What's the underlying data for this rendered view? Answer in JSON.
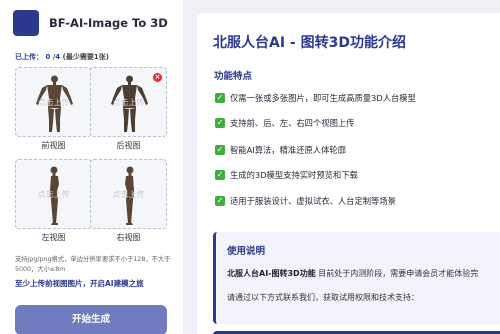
{
  "app": {
    "title": "BF-AI-Image To 3D"
  },
  "upload": {
    "status_label": "已上传：",
    "status_count": "0 /4",
    "status_note": "(最少需要1张)",
    "placeholder": "点击上传",
    "slots": [
      {
        "label": "前视图",
        "has_remove": false
      },
      {
        "label": "后视图",
        "has_remove": true
      },
      {
        "label": "左视图",
        "has_remove": false
      },
      {
        "label": "右视图",
        "has_remove": false
      }
    ],
    "remove_glyph": "×",
    "hint": "支持jpg/png格式，单边分辨率要求不小于128，不大于5000，大小≤8m",
    "hint_strong": "至少上传前视图图片，开启AI建模之旅",
    "start_label": "开始生成"
  },
  "intro": {
    "title": "北服人台AI - 图转3D功能介绍",
    "features_title": "功能特点",
    "check_glyph": "✓",
    "features": [
      "仅需一张或多张图片，即可生成高质量3D人台模型",
      "支持前、后、左、右四个视图上传",
      "智能AI算法，精准还原人体轮廓",
      "生成的3D模型支持实时预览和下载",
      "适用于服装设计、虚拟试衣、人台定制等场景"
    ],
    "usage_title": "使用说明",
    "usage_bold": "北服人台AI-图转3D功能",
    "usage_text": " 目前处于内测阶段，需要申请会员才能体验完",
    "usage_contact": "请通过以下方式联系我们，获取试用权限和技术支持："
  },
  "colors": {
    "accent": "#2b3a8c",
    "button": "#6e7bbd",
    "check": "#3fae3f",
    "remove": "#e02d3a"
  }
}
